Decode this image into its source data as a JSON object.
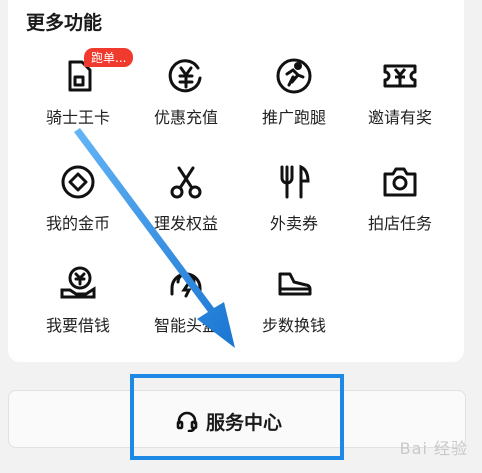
{
  "section": {
    "title": "更多功能"
  },
  "tiles": [
    {
      "label": "骑士王卡",
      "icon": "sim-card-icon",
      "badge": "跑单..."
    },
    {
      "label": "优惠充值",
      "icon": "yuan-coin-icon"
    },
    {
      "label": "推广跑腿",
      "icon": "runner-icon"
    },
    {
      "label": "邀请有奖",
      "icon": "coupon-ticket-icon"
    },
    {
      "label": "我的金币",
      "icon": "gold-coin-icon"
    },
    {
      "label": "理发权益",
      "icon": "scissors-icon"
    },
    {
      "label": "外卖券",
      "icon": "fork-knife-icon"
    },
    {
      "label": "拍店任务",
      "icon": "camera-icon"
    },
    {
      "label": "我要借钱",
      "icon": "hand-money-icon"
    },
    {
      "label": "智能头盔",
      "icon": "helmet-icon"
    },
    {
      "label": "步数换钱",
      "icon": "sneaker-icon"
    }
  ],
  "bottom": {
    "service_label": "服务中心",
    "icon": "headset-icon"
  },
  "annotation": {
    "color": "#1e88e5"
  },
  "watermark": {
    "text": "Bai 经验"
  }
}
